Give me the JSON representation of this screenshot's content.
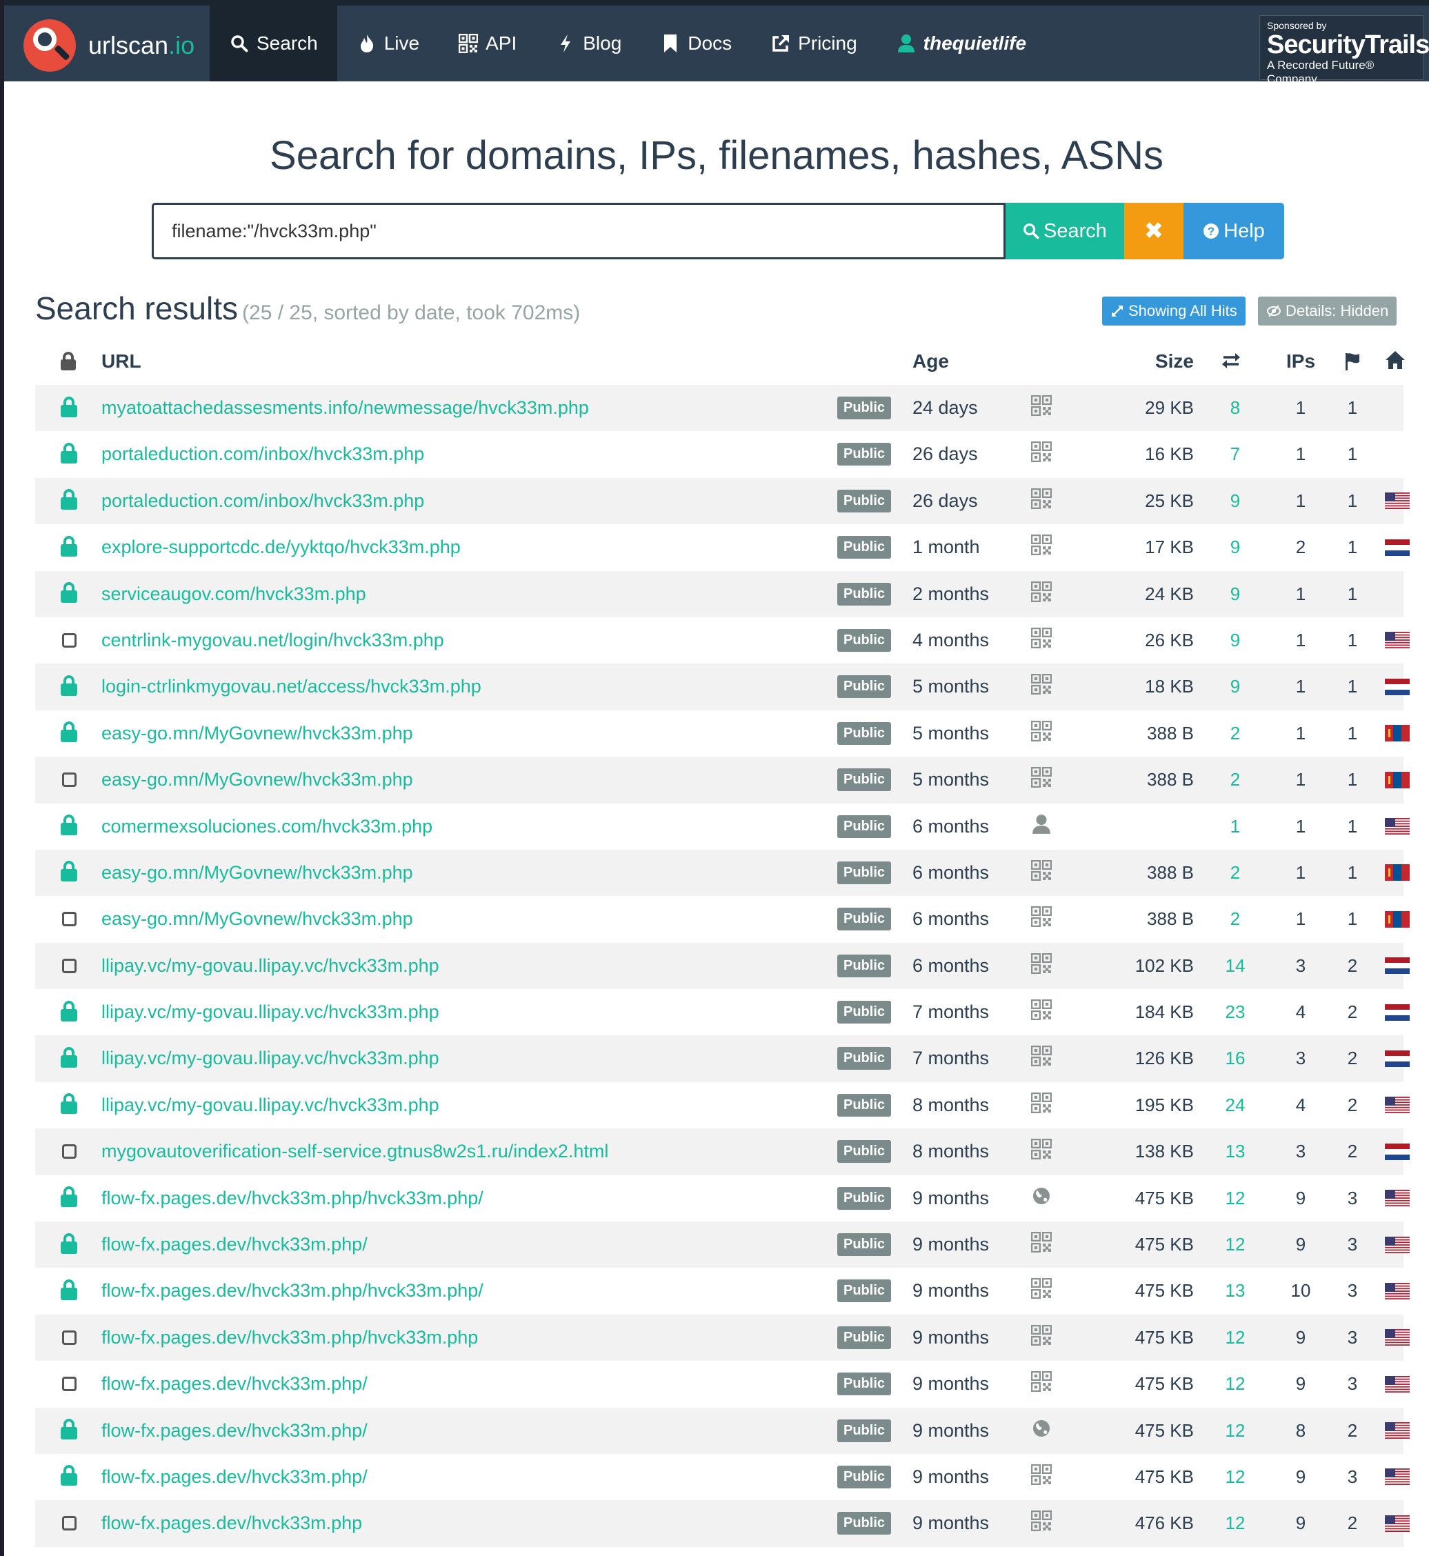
{
  "brand": {
    "name": "urlscan",
    "tld": ".io"
  },
  "nav": [
    {
      "label": "Search",
      "icon": "search-icon",
      "active": true
    },
    {
      "label": "Live",
      "icon": "fire-icon"
    },
    {
      "label": "API",
      "icon": "qrcode-icon"
    },
    {
      "label": "Blog",
      "icon": "bolt-icon"
    },
    {
      "label": "Docs",
      "icon": "bookmark-icon"
    },
    {
      "label": "Pricing",
      "icon": "external-link-icon"
    },
    {
      "label": "thequietlife",
      "icon": "user-icon"
    }
  ],
  "sponsor": {
    "line1": "Sponsored by",
    "line2": "SecurityTrails",
    "line3": "A Recorded Future® Company"
  },
  "headline": "Search for domains, IPs, filenames, hashes, ASNs",
  "search": {
    "value": "filename:\"/hvck33m.php\"",
    "button": "Search",
    "clear": "✖",
    "help": "Help"
  },
  "results": {
    "title": "Search results",
    "meta": "(25 / 25, sorted by date, took 702ms)",
    "hits_button": "Showing All Hits",
    "details_button": "Details: Hidden"
  },
  "columns": {
    "url": "URL",
    "age": "Age",
    "size": "Size",
    "ips": "IPs"
  },
  "colors": {
    "nav": "#2c3e50",
    "accent": "#18bc9c",
    "orange": "#f39c12",
    "blue": "#3498db"
  },
  "rows": [
    {
      "lock": "closed",
      "url": "myatoattachedassesments.info/newmessage/hvck33m.php",
      "visibility": "Public",
      "age": "24 days",
      "thumb": "qr",
      "size": "29 KB",
      "requests": "8",
      "ips": "1",
      "countries": "1",
      "flag": ""
    },
    {
      "lock": "closed",
      "url": "portaleduction.com/inbox/hvck33m.php",
      "visibility": "Public",
      "age": "26 days",
      "thumb": "qr",
      "size": "16 KB",
      "requests": "7",
      "ips": "1",
      "countries": "1",
      "flag": ""
    },
    {
      "lock": "closed",
      "url": "portaleduction.com/inbox/hvck33m.php",
      "visibility": "Public",
      "age": "26 days",
      "thumb": "qr",
      "size": "25 KB",
      "requests": "9",
      "ips": "1",
      "countries": "1",
      "flag": "us"
    },
    {
      "lock": "closed",
      "url": "explore-supportcdc.de/yyktqo/hvck33m.php",
      "visibility": "Public",
      "age": "1 month",
      "thumb": "qr",
      "size": "17 KB",
      "requests": "9",
      "ips": "2",
      "countries": "1",
      "flag": "nl"
    },
    {
      "lock": "closed",
      "url": "serviceaugov.com/hvck33m.php",
      "visibility": "Public",
      "age": "2 months",
      "thumb": "qr",
      "size": "24 KB",
      "requests": "9",
      "ips": "1",
      "countries": "1",
      "flag": ""
    },
    {
      "lock": "open",
      "url": "centrlink-mygovau.net/login/hvck33m.php",
      "visibility": "Public",
      "age": "4 months",
      "thumb": "qr",
      "size": "26 KB",
      "requests": "9",
      "ips": "1",
      "countries": "1",
      "flag": "us"
    },
    {
      "lock": "closed",
      "url": "login-ctrlinkmygovau.net/access/hvck33m.php",
      "visibility": "Public",
      "age": "5 months",
      "thumb": "qr",
      "size": "18 KB",
      "requests": "9",
      "ips": "1",
      "countries": "1",
      "flag": "nl"
    },
    {
      "lock": "closed",
      "url": "easy-go.mn/MyGovnew/hvck33m.php",
      "visibility": "Public",
      "age": "5 months",
      "thumb": "qr",
      "size": "388 B",
      "requests": "2",
      "ips": "1",
      "countries": "1",
      "flag": "mn"
    },
    {
      "lock": "open",
      "url": "easy-go.mn/MyGovnew/hvck33m.php",
      "visibility": "Public",
      "age": "5 months",
      "thumb": "qr",
      "size": "388 B",
      "requests": "2",
      "ips": "1",
      "countries": "1",
      "flag": "mn"
    },
    {
      "lock": "closed",
      "url": "comermexsoluciones.com/hvck33m.php",
      "visibility": "Public",
      "age": "6 months",
      "thumb": "user",
      "size": "",
      "requests": "1",
      "ips": "1",
      "countries": "1",
      "flag": "us"
    },
    {
      "lock": "closed",
      "url": "easy-go.mn/MyGovnew/hvck33m.php",
      "visibility": "Public",
      "age": "6 months",
      "thumb": "qr",
      "size": "388 B",
      "requests": "2",
      "ips": "1",
      "countries": "1",
      "flag": "mn"
    },
    {
      "lock": "open",
      "url": "easy-go.mn/MyGovnew/hvck33m.php",
      "visibility": "Public",
      "age": "6 months",
      "thumb": "qr",
      "size": "388 B",
      "requests": "2",
      "ips": "1",
      "countries": "1",
      "flag": "mn"
    },
    {
      "lock": "open",
      "url": "llipay.vc/my-govau.llipay.vc/hvck33m.php",
      "visibility": "Public",
      "age": "6 months",
      "thumb": "qr",
      "size": "102 KB",
      "requests": "14",
      "ips": "3",
      "countries": "2",
      "flag": "nl"
    },
    {
      "lock": "closed",
      "url": "llipay.vc/my-govau.llipay.vc/hvck33m.php",
      "visibility": "Public",
      "age": "7 months",
      "thumb": "qr",
      "size": "184 KB",
      "requests": "23",
      "ips": "4",
      "countries": "2",
      "flag": "nl"
    },
    {
      "lock": "closed",
      "url": "llipay.vc/my-govau.llipay.vc/hvck33m.php",
      "visibility": "Public",
      "age": "7 months",
      "thumb": "qr",
      "size": "126 KB",
      "requests": "16",
      "ips": "3",
      "countries": "2",
      "flag": "nl"
    },
    {
      "lock": "closed",
      "url": "llipay.vc/my-govau.llipay.vc/hvck33m.php",
      "visibility": "Public",
      "age": "8 months",
      "thumb": "qr",
      "size": "195 KB",
      "requests": "24",
      "ips": "4",
      "countries": "2",
      "flag": "us"
    },
    {
      "lock": "open",
      "url": "mygovautoverification-self-service.gtnus8w2s1.ru/index2.html",
      "visibility": "Public",
      "age": "8 months",
      "thumb": "qr",
      "size": "138 KB",
      "requests": "13",
      "ips": "3",
      "countries": "2",
      "flag": "nl"
    },
    {
      "lock": "closed",
      "url": "flow-fx.pages.dev/hvck33m.php/hvck33m.php/",
      "visibility": "Public",
      "age": "9 months",
      "thumb": "globe",
      "size": "475 KB",
      "requests": "12",
      "ips": "9",
      "countries": "3",
      "flag": "us"
    },
    {
      "lock": "closed",
      "url": "flow-fx.pages.dev/hvck33m.php/",
      "visibility": "Public",
      "age": "9 months",
      "thumb": "qr",
      "size": "475 KB",
      "requests": "12",
      "ips": "9",
      "countries": "3",
      "flag": "us"
    },
    {
      "lock": "closed",
      "url": "flow-fx.pages.dev/hvck33m.php/hvck33m.php/",
      "visibility": "Public",
      "age": "9 months",
      "thumb": "qr",
      "size": "475 KB",
      "requests": "13",
      "ips": "10",
      "countries": "3",
      "flag": "us"
    },
    {
      "lock": "open",
      "url": "flow-fx.pages.dev/hvck33m.php/hvck33m.php",
      "visibility": "Public",
      "age": "9 months",
      "thumb": "qr",
      "size": "475 KB",
      "requests": "12",
      "ips": "9",
      "countries": "3",
      "flag": "us"
    },
    {
      "lock": "open",
      "url": "flow-fx.pages.dev/hvck33m.php/",
      "visibility": "Public",
      "age": "9 months",
      "thumb": "qr",
      "size": "475 KB",
      "requests": "12",
      "ips": "9",
      "countries": "3",
      "flag": "us"
    },
    {
      "lock": "closed",
      "url": "flow-fx.pages.dev/hvck33m.php/",
      "visibility": "Public",
      "age": "9 months",
      "thumb": "globe",
      "size": "475 KB",
      "requests": "12",
      "ips": "8",
      "countries": "2",
      "flag": "us"
    },
    {
      "lock": "closed",
      "url": "flow-fx.pages.dev/hvck33m.php/",
      "visibility": "Public",
      "age": "9 months",
      "thumb": "qr",
      "size": "475 KB",
      "requests": "12",
      "ips": "9",
      "countries": "3",
      "flag": "us"
    },
    {
      "lock": "open",
      "url": "flow-fx.pages.dev/hvck33m.php",
      "visibility": "Public",
      "age": "9 months",
      "thumb": "qr",
      "size": "476 KB",
      "requests": "12",
      "ips": "9",
      "countries": "2",
      "flag": "us"
    }
  ]
}
